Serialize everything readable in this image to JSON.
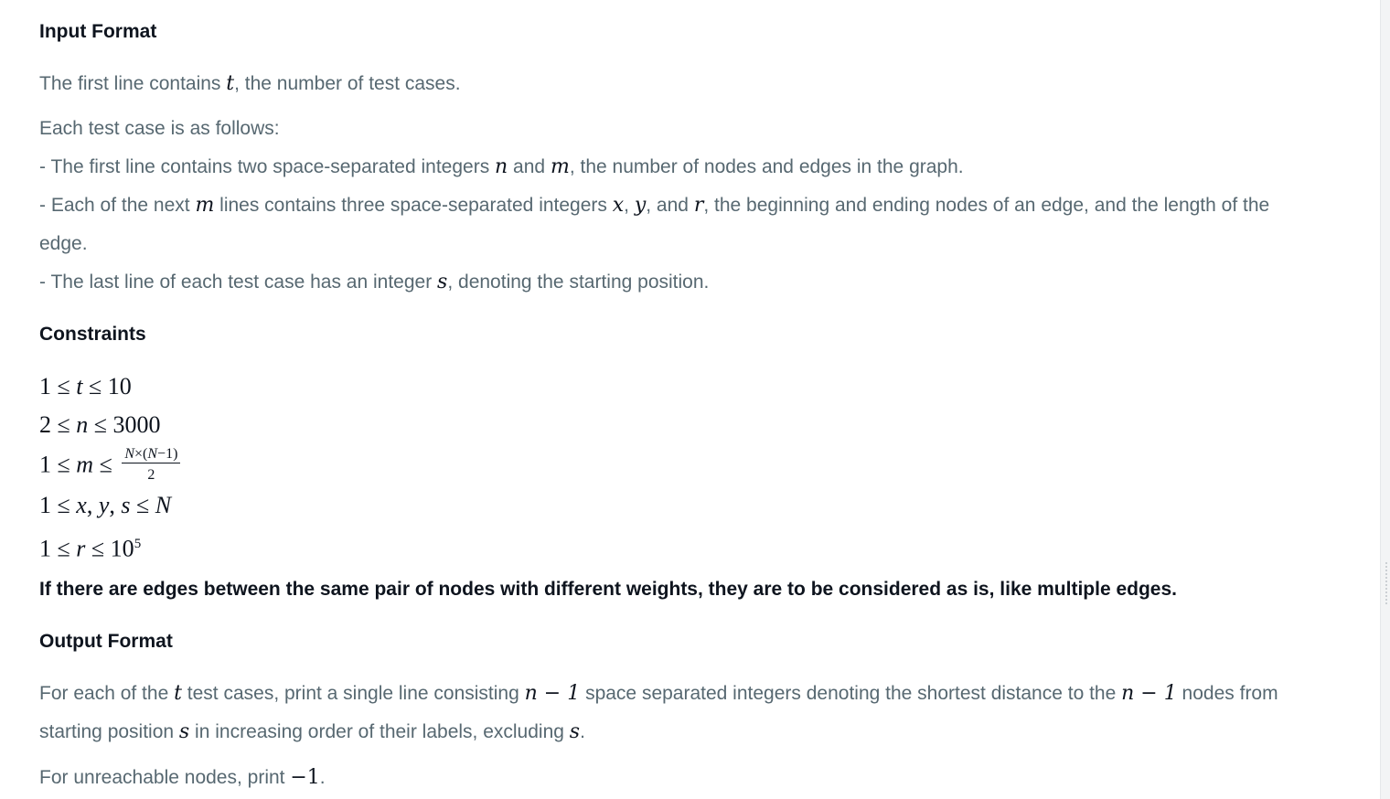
{
  "sections": {
    "input_format": {
      "heading": "Input Format",
      "first_line_a": "The first line contains ",
      "first_line_var": "t",
      "first_line_b": ", the number of test cases.",
      "each_test_case": "Each test case is as follows:",
      "bullet1_a": "- The first line contains two space-separated integers ",
      "bullet1_var_n": "n",
      "bullet1_and": " and ",
      "bullet1_var_m": "m",
      "bullet1_b": ", the number of nodes and edges in the graph.",
      "bullet2_a": "- Each of the next ",
      "bullet2_var_m": "m",
      "bullet2_b": " lines contains three space-separated integers ",
      "bullet2_var_x": "x",
      "bullet2_comma": ", ",
      "bullet2_var_y": "y",
      "bullet2_and": ", and ",
      "bullet2_var_r": "r",
      "bullet2_c": ", the beginning and ending nodes of an edge, and the length of the",
      "bullet2_d": "edge.",
      "bullet3_a": "- The last line of each test case has an integer ",
      "bullet3_var_s": "s",
      "bullet3_b": ", denoting the starting position."
    },
    "constraints": {
      "heading": "Constraints",
      "c1": "1 ≤ t ≤ 10",
      "c2": "2 ≤ n ≤ 3000",
      "c3_prefix": "1 ≤ m ≤",
      "c3_num": "N×(N−1)",
      "c3_den": "2",
      "c4": "1 ≤ x, y, s ≤ N",
      "c5_prefix": "1 ≤ r ≤ 10",
      "c5_exp": "5",
      "note": "If there are edges between the same pair of nodes with different weights, they are to be considered as is, like multiple edges."
    },
    "output_format": {
      "heading": "Output Format",
      "line1_a": "For each of the ",
      "line1_var_t": "t",
      "line1_b": " test cases, print a single line consisting ",
      "line1_expr1": "n − 1",
      "line1_c": " space separated integers denoting the shortest distance to the ",
      "line1_expr2": "n − 1",
      "line1_d": " nodes from",
      "line2_a": "starting position ",
      "line2_var_s": "s",
      "line2_b": " in increasing order of their labels, excluding ",
      "line2_var_s2": "s",
      "line2_c": ".",
      "unreachable_a": "For unreachable nodes, print ",
      "unreachable_val": "−1",
      "unreachable_b": "."
    }
  }
}
